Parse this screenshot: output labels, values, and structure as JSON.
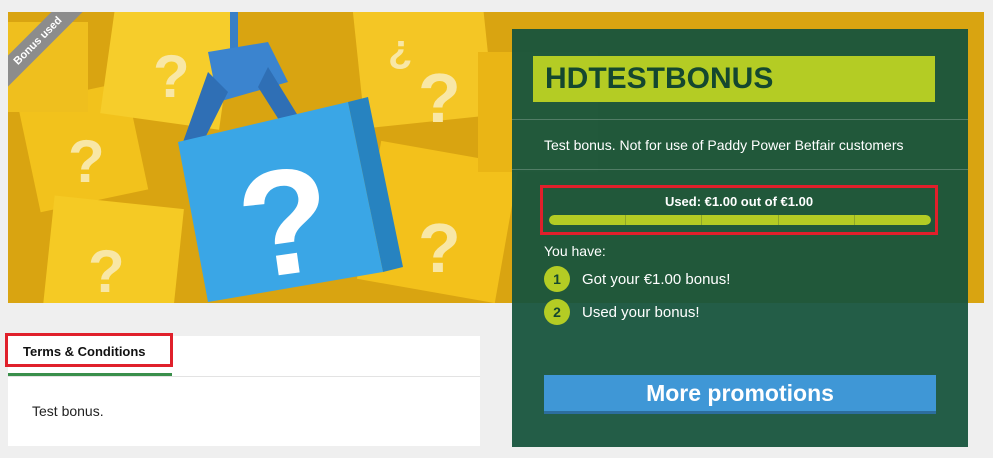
{
  "hero": {
    "badge": "Bonus used",
    "image": "mystery-box-claw-illustration"
  },
  "bonus": {
    "title": "HDTESTBONUS",
    "description": "Test bonus. Not for use of Paddy Power Betfair customers",
    "used_label": "Used: €1.00 out of €1.00",
    "used_fraction": 1.0,
    "you_have": "You have:",
    "steps": [
      {
        "num": "1",
        "text": "Got your €1.00 bonus!"
      },
      {
        "num": "2",
        "text": "Used your bonus!"
      }
    ],
    "button": "More promotions"
  },
  "terms": {
    "tab": "Terms & Conditions",
    "body": "Test bonus."
  },
  "colors": {
    "panel": "#17543d",
    "accent": "#b4cc24",
    "button": "#3f97d6",
    "highlight": "#e0202b"
  }
}
